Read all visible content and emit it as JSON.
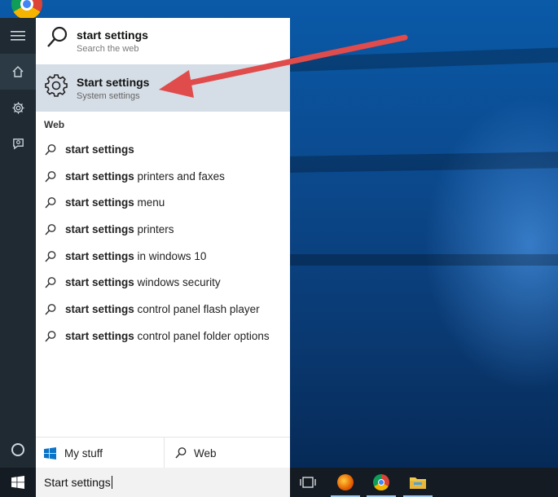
{
  "search": {
    "query": "Start settings"
  },
  "best_match": {
    "title": "start settings",
    "subtitle": "Search the web"
  },
  "settings_result": {
    "title": "Start settings",
    "subtitle": "System settings"
  },
  "web_section": {
    "heading": "Web",
    "items": [
      {
        "bold": "start settings",
        "rest": ""
      },
      {
        "bold": "start settings",
        "rest": " printers and faxes"
      },
      {
        "bold": "start settings",
        "rest": " menu"
      },
      {
        "bold": "start settings",
        "rest": " printers"
      },
      {
        "bold": "start settings",
        "rest": " in windows 10"
      },
      {
        "bold": "start settings",
        "rest": " windows security"
      },
      {
        "bold": "start settings",
        "rest": " control panel flash player"
      },
      {
        "bold": "start settings",
        "rest": " control panel folder options"
      }
    ]
  },
  "bottom_tabs": {
    "my_stuff": "My stuff",
    "web": "Web"
  },
  "icons": {
    "rail": [
      "hamburger-menu-icon",
      "home-icon",
      "settings-gear-icon",
      "feedback-icon",
      "cortana-icon"
    ],
    "taskbar": [
      "windows-start-icon",
      "task-view-icon",
      "firefox-icon",
      "chrome-icon",
      "file-explorer-icon"
    ]
  },
  "colors": {
    "arrow": "#e04b4b",
    "highlight": "#d5dde6",
    "rail": "#1f2a33",
    "taskbar": "#141b22"
  }
}
